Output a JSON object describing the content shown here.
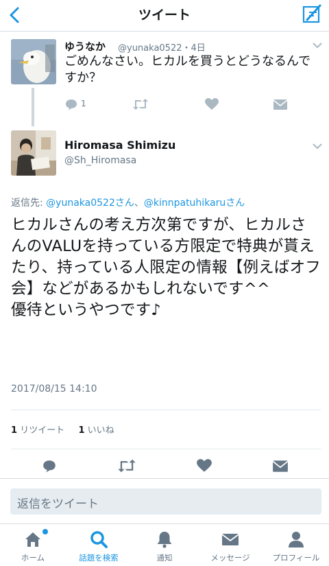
{
  "header": {
    "title": "ツイート"
  },
  "previous_tweet": {
    "name": "ゆうなか",
    "handle": "@yunaka0522・4日",
    "text": "ごめんなさい。ヒカルを買うとどうなるんですか？",
    "reply_count": "1"
  },
  "main_tweet": {
    "name": "Hiromasa Shimizu",
    "handle": "@Sh_Hiromasa",
    "reply_prefix": "返信先: ",
    "mention1": "@yunaka0522さん",
    "reply_sep": "、",
    "mention2": "@kinnpatuhikaruさん",
    "text": "ヒカルさんの考え方次第ですが、ヒカルさんのVALUを持っている方限定で特典が貰えたり、持っている人限定の情報【例えばオフ会】などがあるかもしれないです^^\n優待というやつです♪",
    "timestamp": "2017/08/15 14:10",
    "retweet_count": "1",
    "retweet_label": "リツイート",
    "like_count": "1",
    "like_label": "いいね"
  },
  "reply_box": {
    "placeholder": "返信をツイート"
  },
  "tabs": [
    {
      "label": "ホーム",
      "icon": "home-icon"
    },
    {
      "label": "話題を検索",
      "icon": "search-icon"
    },
    {
      "label": "通知",
      "icon": "bell-icon"
    },
    {
      "label": "メッセージ",
      "icon": "envelope-icon"
    },
    {
      "label": "プロフィール",
      "icon": "person-icon"
    }
  ],
  "colors": {
    "accent": "#1b95e0",
    "muted": "#657786",
    "text": "#14171a"
  }
}
